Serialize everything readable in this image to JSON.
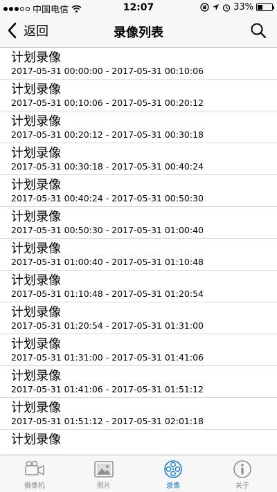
{
  "status_bar": {
    "carrier": "中国电信",
    "time": "12:07",
    "battery": "33%",
    "battery_level": 0.33
  },
  "nav": {
    "back_label": "返回",
    "title": "录像列表"
  },
  "records": [
    {
      "title": "计划录像",
      "range": "2017-05-31 00:00:00 - 2017-05-31 00:10:06"
    },
    {
      "title": "计划录像",
      "range": "2017-05-31 00:10:06 - 2017-05-31 00:20:12"
    },
    {
      "title": "计划录像",
      "range": "2017-05-31 00:20:12 - 2017-05-31 00:30:18"
    },
    {
      "title": "计划录像",
      "range": "2017-05-31 00:30:18 - 2017-05-31 00:40:24"
    },
    {
      "title": "计划录像",
      "range": "2017-05-31 00:40:24 - 2017-05-31 00:50:30"
    },
    {
      "title": "计划录像",
      "range": "2017-05-31 00:50:30 - 2017-05-31 01:00:40"
    },
    {
      "title": "计划录像",
      "range": "2017-05-31 01:00:40 - 2017-05-31 01:10:48"
    },
    {
      "title": "计划录像",
      "range": "2017-05-31 01:10:48 - 2017-05-31 01:20:54"
    },
    {
      "title": "计划录像",
      "range": "2017-05-31 01:20:54 - 2017-05-31 01:31:00"
    },
    {
      "title": "计划录像",
      "range": "2017-05-31 01:31:00 - 2017-05-31 01:41:06"
    },
    {
      "title": "计划录像",
      "range": "2017-05-31 01:41:06 - 2017-05-31 01:51:12"
    },
    {
      "title": "计划录像",
      "range": "2017-05-31 01:51:12 - 2017-05-31 02:01:18"
    },
    {
      "title": "计划录像",
      "range": ""
    }
  ],
  "tabs": [
    {
      "label": "摄像机",
      "icon": "camera-icon",
      "active": false
    },
    {
      "label": "照片",
      "icon": "photos-icon",
      "active": false
    },
    {
      "label": "录像",
      "icon": "film-reel-icon",
      "active": true
    },
    {
      "label": "关于",
      "icon": "info-icon",
      "active": false
    }
  ],
  "colors": {
    "accent": "#1a7fd6",
    "tab_inactive": "#8e8e93",
    "bar_background": "#f7f7f7"
  }
}
